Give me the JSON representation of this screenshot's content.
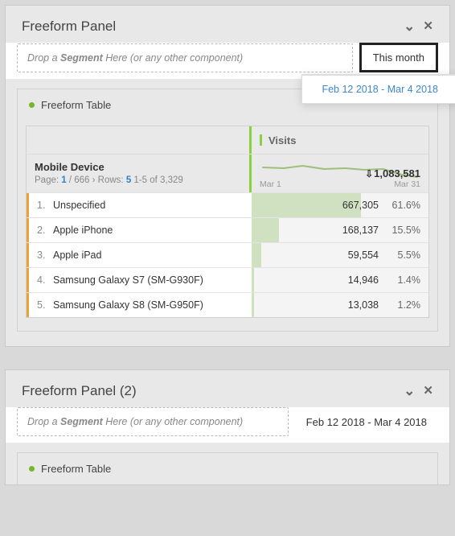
{
  "panels": [
    {
      "title": "Freeform Panel",
      "dropzone_text_prefix": "Drop a ",
      "dropzone_segment_word": "Segment",
      "dropzone_text_suffix": " Here (or any other component)",
      "date_label": "This month",
      "date_range_popup": "Feb 12 2018 - Mar 4 2018",
      "date_highlighted": true,
      "card": {
        "title": "Freeform Table",
        "metric": "Visits",
        "dimension": "Mobile Device",
        "pager_prefix": "Page: ",
        "page_cur": "1",
        "page_sep": " / ",
        "page_total": "666",
        "rows_prefix": " Rows: ",
        "rows": "5",
        "range_text": "  1-5 of 3,329",
        "spark_start": "Mar 1",
        "spark_end": "Mar 31",
        "total": "1,083,581",
        "rows_data": [
          {
            "n": "1.",
            "label": "Unspecified",
            "value": "667,305",
            "pct": "61.6%",
            "bar": 61.6
          },
          {
            "n": "2.",
            "label": "Apple iPhone",
            "value": "168,137",
            "pct": "15.5%",
            "bar": 15.5
          },
          {
            "n": "3.",
            "label": "Apple iPad",
            "value": "59,554",
            "pct": "5.5%",
            "bar": 5.5
          },
          {
            "n": "4.",
            "label": "Samsung Galaxy S7 (SM-G930F)",
            "value": "14,946",
            "pct": "1.4%",
            "bar": 1.4
          },
          {
            "n": "5.",
            "label": "Samsung Galaxy S8 (SM-G950F)",
            "value": "13,038",
            "pct": "1.2%",
            "bar": 1.2
          }
        ]
      }
    },
    {
      "title": "Freeform Panel (2)",
      "dropzone_text_prefix": "Drop a ",
      "dropzone_segment_word": "Segment",
      "dropzone_text_suffix": " Here (or any other component)",
      "date_label": "Feb 12 2018 - Mar 4 2018",
      "date_highlighted": false,
      "card": {
        "title": "Freeform Table"
      }
    }
  ],
  "chart_data": {
    "type": "table",
    "title": "Visits by Mobile Device",
    "metric": "Visits",
    "dimension": "Mobile Device",
    "total": 1083581,
    "period": {
      "start": "Mar 1",
      "end": "Mar 31"
    },
    "categories": [
      "Unspecified",
      "Apple iPhone",
      "Apple iPad",
      "Samsung Galaxy S7 (SM-G930F)",
      "Samsung Galaxy S8 (SM-G950F)"
    ],
    "values": [
      667305,
      168137,
      59554,
      14946,
      13038
    ],
    "percentages": [
      61.6,
      15.5,
      5.5,
      1.4,
      1.2
    ]
  }
}
